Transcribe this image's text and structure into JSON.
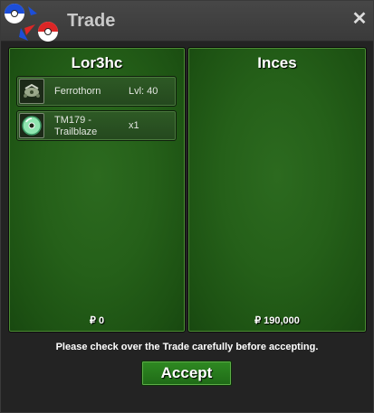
{
  "window": {
    "title": "Trade",
    "close_glyph": "✕"
  },
  "left_panel": {
    "name": "Lor3hc",
    "money": "₽ 0",
    "items": [
      {
        "icon": "pokemon-icon",
        "name": "Ferrothorn",
        "meta": "Lvl: 40"
      },
      {
        "icon": "disc-icon",
        "name": "TM179 - Trailblaze",
        "meta": "x1"
      }
    ]
  },
  "right_panel": {
    "name": "Inces",
    "money": "₽ 190,000"
  },
  "footer": {
    "notice": "Please check over the Trade carefully before accepting.",
    "accept_label": "Accept"
  },
  "colors": {
    "panel_green": "#256019",
    "button_green": "#2f8a22",
    "titlebar": "#474747"
  }
}
